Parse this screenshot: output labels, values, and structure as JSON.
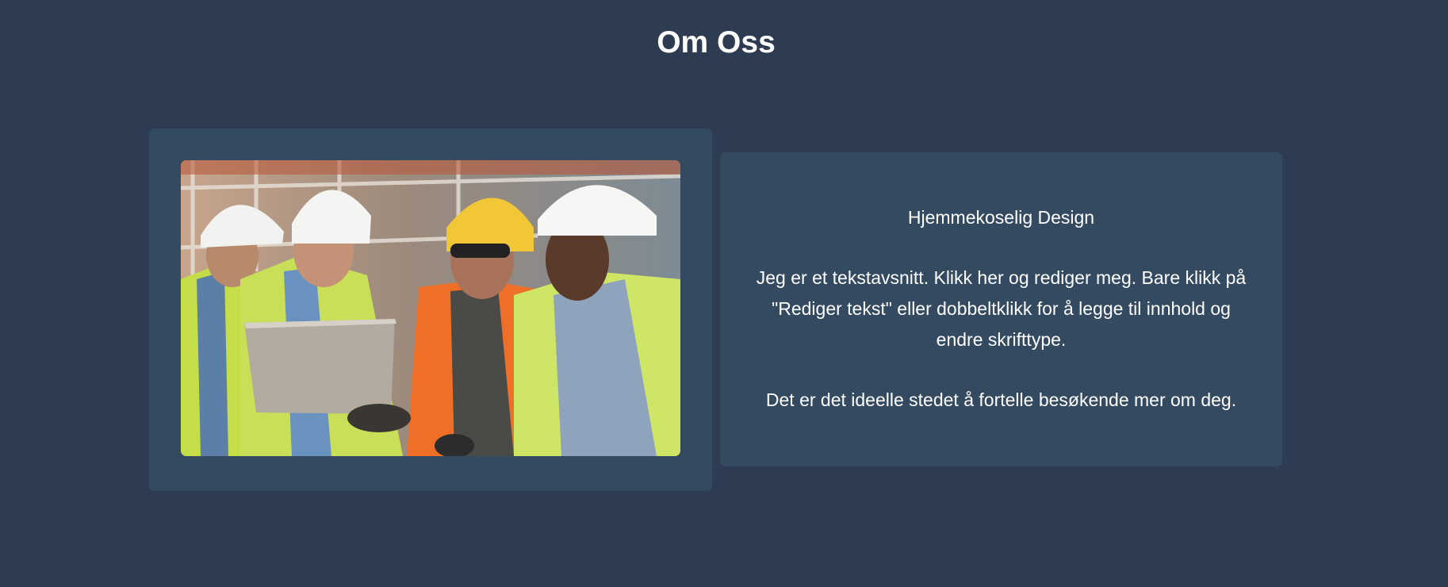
{
  "section": {
    "title": "Om Oss"
  },
  "about": {
    "heading": "Hjemmekoselig Design",
    "paragraph_1": "Jeg er et tekstavsnitt. Klikk her og rediger meg. Bare klikk på \"Rediger tekst\" eller dobbeltklikk for å legge til innhold og endre skrifttype.",
    "paragraph_2": "Det er det ideelle stedet å fortelle besøkende mer om deg."
  },
  "colors": {
    "background": "#2d3c50",
    "card": "#344a61",
    "text": "#ffffff"
  }
}
